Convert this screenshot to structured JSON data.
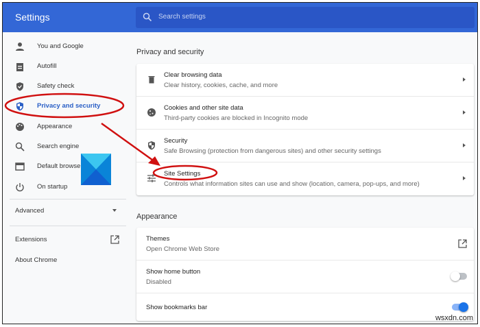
{
  "header": {
    "title": "Settings",
    "search_placeholder": "Search settings"
  },
  "sidebar": {
    "items": [
      {
        "label": "You and Google",
        "icon": "person-icon"
      },
      {
        "label": "Autofill",
        "icon": "clipboard-icon"
      },
      {
        "label": "Safety check",
        "icon": "shield-check-icon"
      },
      {
        "label": "Privacy and security",
        "icon": "shield-icon",
        "active": true
      },
      {
        "label": "Appearance",
        "icon": "palette-icon"
      },
      {
        "label": "Search engine",
        "icon": "search-icon"
      },
      {
        "label": "Default browser",
        "icon": "browser-icon"
      },
      {
        "label": "On startup",
        "icon": "power-icon"
      }
    ],
    "advanced": "Advanced",
    "extensions": "Extensions",
    "about": "About Chrome"
  },
  "privacy": {
    "heading": "Privacy and security",
    "rows": [
      {
        "title": "Clear browsing data",
        "sub": "Clear history, cookies, cache, and more"
      },
      {
        "title": "Cookies and other site data",
        "sub": "Third-party cookies are blocked in Incognito mode"
      },
      {
        "title": "Security",
        "sub": "Safe Browsing (protection from dangerous sites) and other security settings"
      },
      {
        "title": "Site Settings",
        "sub": "Controls what information sites can use and show (location, camera, pop-ups, and more)"
      }
    ]
  },
  "appearance": {
    "heading": "Appearance",
    "rows": [
      {
        "title": "Themes",
        "sub": "Open Chrome Web Store"
      },
      {
        "title": "Show home button",
        "sub": "Disabled",
        "toggle": false
      },
      {
        "title": "Show bookmarks bar",
        "toggle": true
      }
    ]
  },
  "colors": {
    "header": "#3367d6",
    "accent": "#1a73e8",
    "annotation": "#d01010"
  },
  "watermark": "wsxdn.com"
}
